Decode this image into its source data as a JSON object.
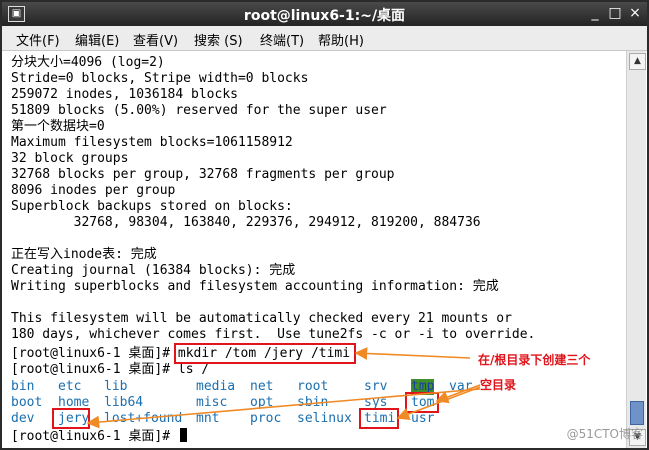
{
  "window": {
    "title": "root@linux6-1:~/桌面",
    "app_icon": "terminal-icon",
    "controls": [
      "_",
      "□",
      "×"
    ]
  },
  "menu": [
    "文件(F)",
    "编辑(E)",
    "查看(V)",
    "搜索 (S)",
    "终端(T)",
    "帮助(H)"
  ],
  "terminal": {
    "lines": [
      "分块大小=4096 (log=2)",
      "Stride=0 blocks, Stripe width=0 blocks",
      "259072 inodes, 1036184 blocks",
      "51809 blocks (5.00%) reserved for the super user",
      "第一个数据块=0",
      "Maximum filesystem blocks=1061158912",
      "32 block groups",
      "32768 blocks per group, 32768 fragments per group",
      "8096 inodes per group",
      "Superblock backups stored on blocks:",
      "        32768, 98304, 163840, 229376, 294912, 819200, 884736",
      "",
      "正在写入inode表: 完成",
      "Creating journal (16384 blocks): 完成",
      "Writing superblocks and filesystem accounting information: 完成",
      "",
      "This filesystem will be automatically checked every 21 mounts or",
      "180 days, whichever comes first.  Use tune2fs -c or -i to override."
    ],
    "prompt": "[root@linux6-1 桌面]# ",
    "cmd1": "mkdir /tom /jery /timi",
    "cmd2": "ls /",
    "ls_rows": [
      [
        "bin",
        "etc",
        "lib",
        "media",
        "net",
        "root",
        "srv",
        "tmp",
        "var"
      ],
      [
        "boot",
        "home",
        "lib64",
        "misc",
        "opt",
        "sbin",
        "sys",
        "tom"
      ],
      [
        "dev",
        "jery",
        "lost+found",
        "mnt",
        "proc",
        "selinux",
        "timi",
        "usr"
      ]
    ],
    "ls_color": "#1a6fb0",
    "tmp_highlight": "#3e8e2a"
  },
  "annotation": {
    "line1": "在/根目录下创建三个",
    "line2": "空目录",
    "color": "#e0141a",
    "arrow_color": "#f08a24"
  },
  "watermark": "@51CTO博客"
}
